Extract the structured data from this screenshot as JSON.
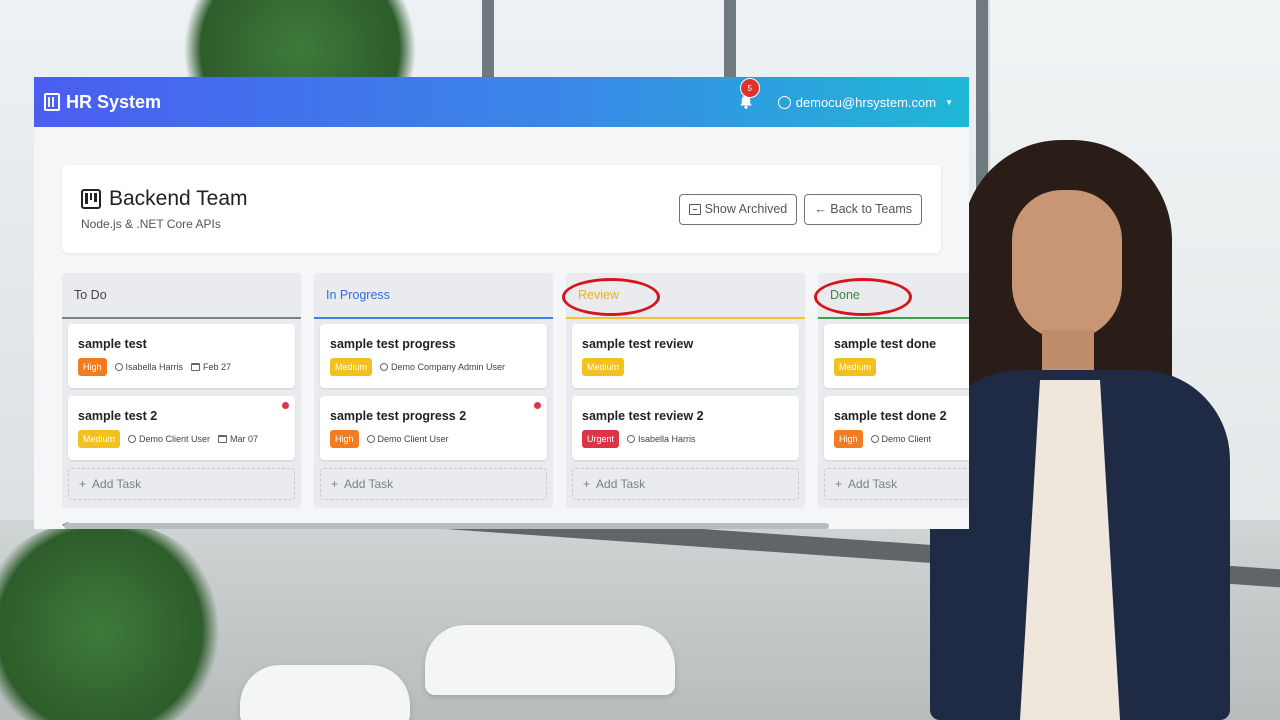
{
  "app": {
    "name": "HR System"
  },
  "navbar": {
    "notification_count": "5",
    "user_email": "democu@hrsystem.com"
  },
  "team": {
    "name": "Backend Team",
    "description": "Node.js & .NET Core APIs"
  },
  "actions": {
    "show_archived": "Show Archived",
    "back_to_teams": "← Back to Teams"
  },
  "columns": [
    {
      "title": "To Do",
      "add_task": "Add Task",
      "tasks": [
        {
          "title": "sample test",
          "priority": "High",
          "assignee": "Isabella Harris",
          "due": "Feb 27"
        },
        {
          "title": "sample test 2",
          "priority": "Medium",
          "assignee": "Demo Client User",
          "due": "Mar 07"
        }
      ]
    },
    {
      "title": "In Progress",
      "add_task": "Add Task",
      "tasks": [
        {
          "title": "sample test progress",
          "priority": "Medium",
          "assignee": "Demo Company Admin User"
        },
        {
          "title": "sample test progress 2",
          "priority": "High",
          "assignee": "Demo Client User"
        }
      ]
    },
    {
      "title": "Review",
      "add_task": "Add Task",
      "tasks": [
        {
          "title": "sample test review",
          "priority": "Medium"
        },
        {
          "title": "sample test review 2",
          "priority": "Urgent",
          "assignee": "Isabella Harris"
        }
      ]
    },
    {
      "title": "Done",
      "add_task": "Add Task",
      "tasks": [
        {
          "title": "sample test done",
          "priority": "Medium"
        },
        {
          "title": "sample test done 2",
          "priority": "High",
          "assignee": "Demo Client"
        }
      ]
    }
  ],
  "colors": {
    "navbar_gradient": [
      "#4a5ef0",
      "#1fb8d6"
    ],
    "high": "#f47c20",
    "medium": "#f3c022",
    "urgent": "#dc3545",
    "annotation_circle": "#d6141c"
  }
}
